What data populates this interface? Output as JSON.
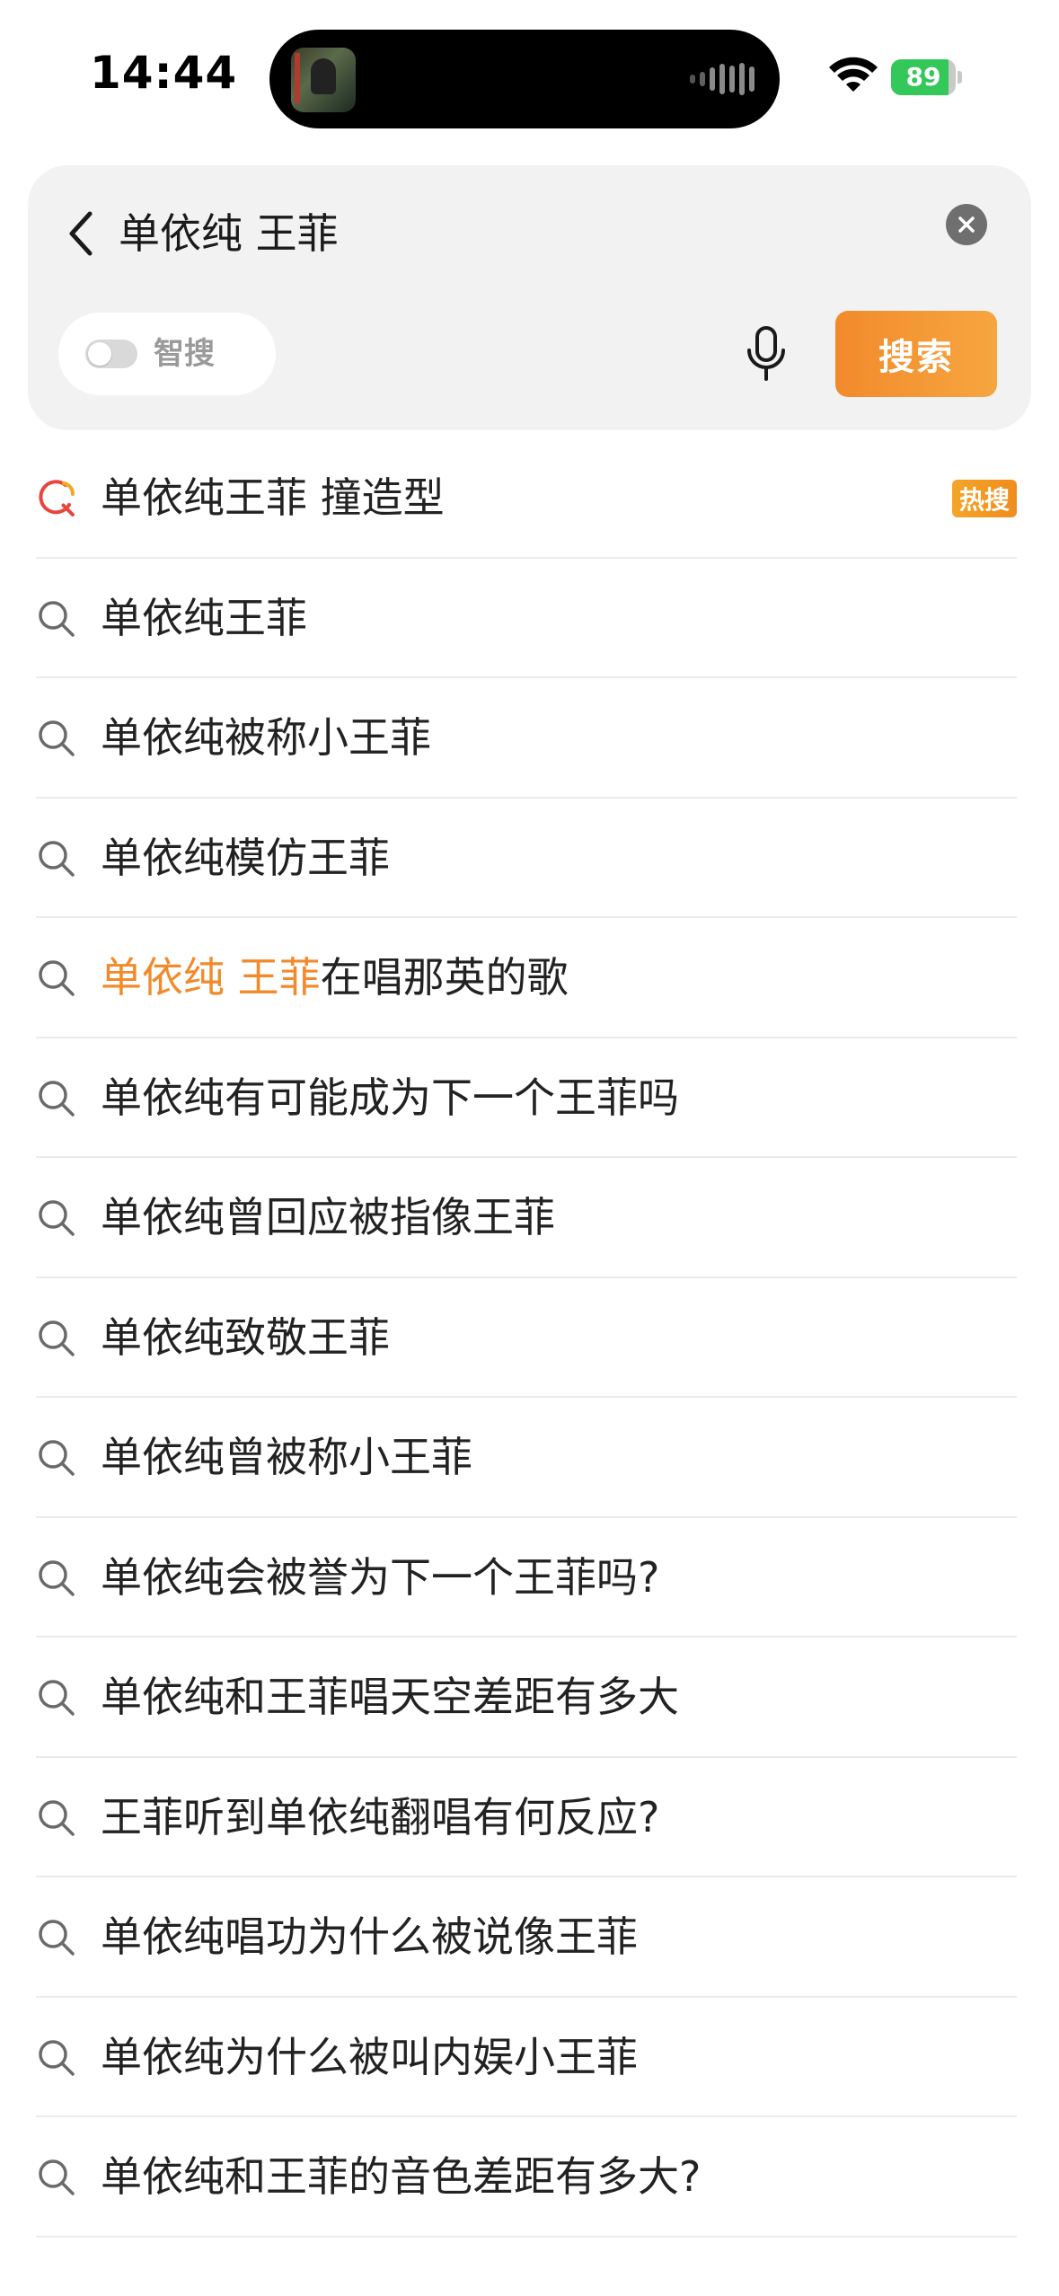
{
  "status_bar": {
    "time": "14:44",
    "battery_level": 89,
    "battery_text": "89"
  },
  "search": {
    "query": "单依纯 王菲",
    "smart_search_label": "智搜",
    "smart_search_enabled": false,
    "search_button_label": "搜索"
  },
  "suggestions": [
    {
      "parts": [
        {
          "t": "单依纯王菲 撞造型",
          "hl": false
        }
      ],
      "badge": "热搜",
      "hot": true
    },
    {
      "parts": [
        {
          "t": "单依纯王菲",
          "hl": false
        }
      ]
    },
    {
      "parts": [
        {
          "t": "单依纯被称小王菲",
          "hl": false
        }
      ]
    },
    {
      "parts": [
        {
          "t": "单依纯模仿王菲",
          "hl": false
        }
      ]
    },
    {
      "parts": [
        {
          "t": "单依纯 王菲",
          "hl": true
        },
        {
          "t": "在唱那英的歌",
          "hl": false
        }
      ]
    },
    {
      "parts": [
        {
          "t": "单依纯有可能成为下一个王菲吗",
          "hl": false
        }
      ]
    },
    {
      "parts": [
        {
          "t": "单依纯曾回应被指像王菲",
          "hl": false
        }
      ]
    },
    {
      "parts": [
        {
          "t": "单依纯致敬王菲",
          "hl": false
        }
      ]
    },
    {
      "parts": [
        {
          "t": "单依纯曾被称小王菲",
          "hl": false
        }
      ]
    },
    {
      "parts": [
        {
          "t": "单依纯会被誉为下一个王菲吗?",
          "hl": false
        }
      ]
    },
    {
      "parts": [
        {
          "t": "单依纯和王菲唱天空差距有多大",
          "hl": false
        }
      ]
    },
    {
      "parts": [
        {
          "t": "王菲听到单依纯翻唱有何反应?",
          "hl": false
        }
      ]
    },
    {
      "parts": [
        {
          "t": "单依纯唱功为什么被说像王菲",
          "hl": false
        }
      ]
    },
    {
      "parts": [
        {
          "t": "单依纯为什么被叫内娱小王菲",
          "hl": false
        }
      ]
    },
    {
      "parts": [
        {
          "t": "单依纯和王菲的音色差距有多大?",
          "hl": false
        }
      ]
    }
  ],
  "colors": {
    "accent": "#f28a2c",
    "hot_badge": "#f39a24",
    "battery_green": "#34c759",
    "hot_icon_red": "#e8453c"
  },
  "icons": {
    "back": "chevron-left-icon",
    "clear": "close-circle-icon",
    "mic": "microphone-icon",
    "search": "search-icon",
    "hot_search": "hot-search-icon"
  }
}
